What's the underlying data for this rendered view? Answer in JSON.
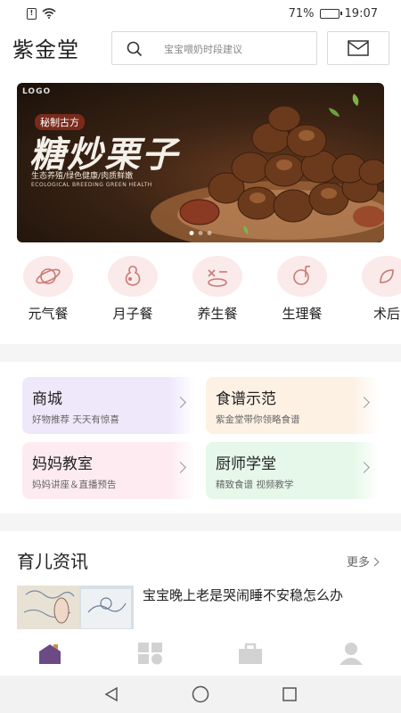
{
  "status_bar": {
    "battery": "71%",
    "time": "19:07",
    "battery_level": 0.71
  },
  "header": {
    "app_title": "紫金堂",
    "search_placeholder": "宝宝喂奶时段建议"
  },
  "banner": {
    "logo": "LOGO",
    "tag": "秘制古方",
    "title": "糖炒栗子",
    "subtitle": "生态养殖/绿色健康/肉质鲜嫩",
    "subtitle_en": "ECOLOGICAL BREEDING GREEN HEALTH"
  },
  "categories": [
    {
      "label": "元气餐",
      "icon": "planet-icon"
    },
    {
      "label": "月子餐",
      "icon": "gourd-icon"
    },
    {
      "label": "养生餐",
      "icon": "cutlery-icon"
    },
    {
      "label": "生理餐",
      "icon": "female-icon"
    },
    {
      "label": "术后",
      "icon": "leaf-icon"
    }
  ],
  "feature_cards": [
    {
      "title": "商城",
      "subtitle": "好物推荐 天天有惊喜",
      "color": "#efe8fb"
    },
    {
      "title": "食谱示范",
      "subtitle": "紫金堂带你领略食谱",
      "color": "#fdf1e4"
    },
    {
      "title": "妈妈教室",
      "subtitle": "妈妈讲座＆直播预告",
      "color": "#fdebf1"
    },
    {
      "title": "厨师学堂",
      "subtitle": "精致食谱 视频教学",
      "color": "#e5f8e9"
    }
  ],
  "news": {
    "section_title": "育儿资讯",
    "more_label": "更多",
    "items": [
      {
        "title": "宝宝晚上老是哭闹睡不安稳怎么办"
      }
    ]
  },
  "colors": {
    "accent": "#6b4a86",
    "nav_inactive": "#d2d2d2",
    "category_bg": "#fbeaea",
    "category_icon": "#c97a74"
  }
}
